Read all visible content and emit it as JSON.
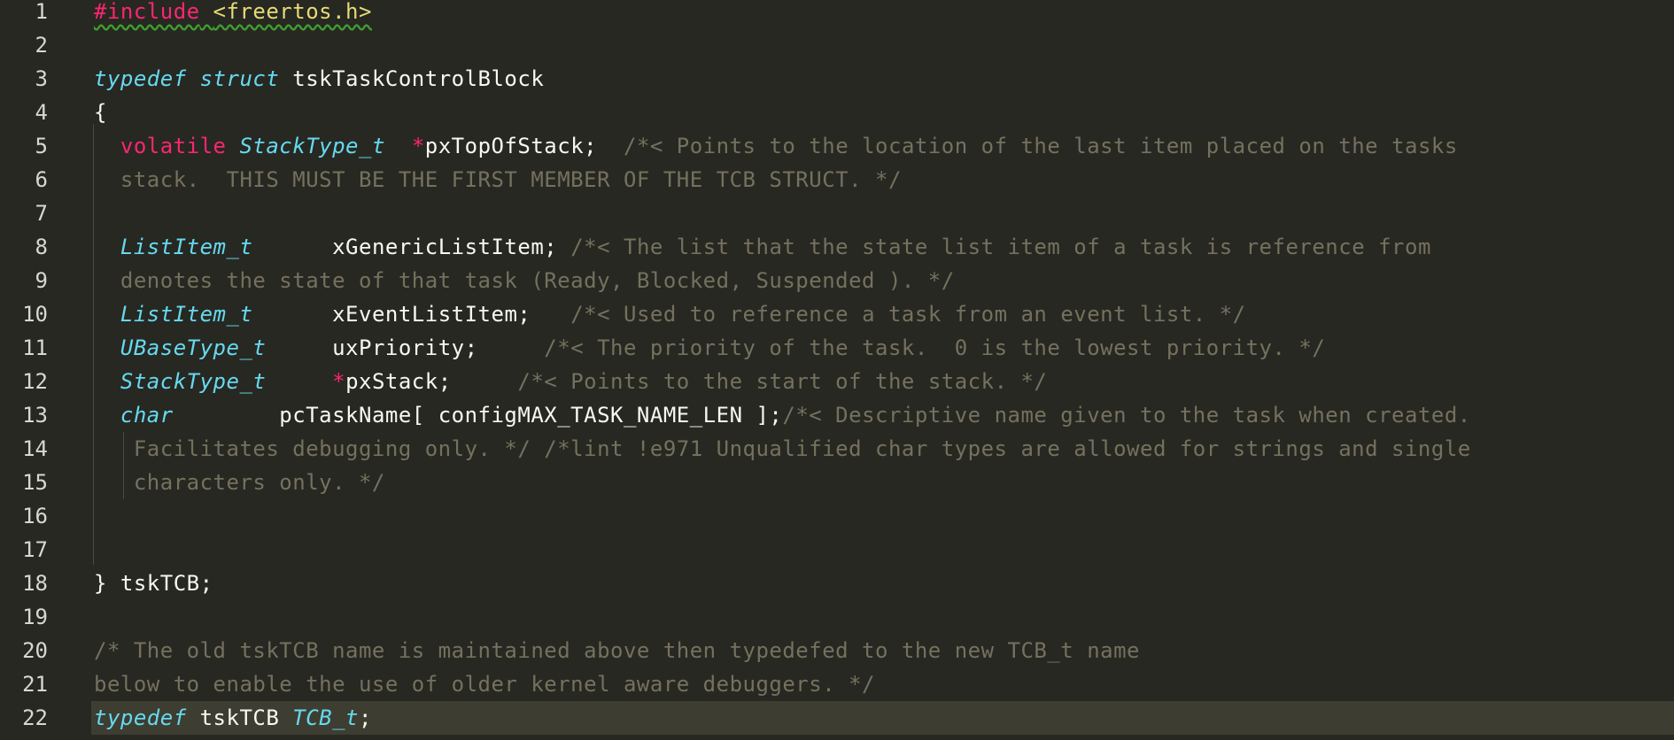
{
  "editor": {
    "theme": "monokai",
    "colors": {
      "background": "#272822",
      "active_line": "#3e3d32",
      "keyword": "#66d9ef",
      "preprocessor": "#f92672",
      "string": "#e6db74",
      "comment": "#75715e",
      "text": "#f8f8f2"
    },
    "active_line_number": "22",
    "lines": [
      {
        "num": "1",
        "tokens": [
          {
            "t": "#include",
            "c": "pre"
          },
          {
            "t": " ",
            "c": "id"
          },
          {
            "t": "<freertos.h>",
            "c": "inc"
          }
        ]
      },
      {
        "num": "2",
        "tokens": []
      },
      {
        "num": "3",
        "tokens": [
          {
            "t": "typedef struct",
            "c": "kw"
          },
          {
            "t": " tskTaskControlBlock",
            "c": "id"
          }
        ]
      },
      {
        "num": "4",
        "tokens": [
          {
            "t": "{",
            "c": "id"
          }
        ]
      },
      {
        "num": "5",
        "tokens": [
          {
            "t": "  ",
            "c": "id"
          },
          {
            "t": "volatile",
            "c": "red"
          },
          {
            "t": " ",
            "c": "id"
          },
          {
            "t": "StackType_t",
            "c": "kw"
          },
          {
            "t": "  ",
            "c": "id"
          },
          {
            "t": "*",
            "c": "red"
          },
          {
            "t": "pxTopOfStack;",
            "c": "id"
          },
          {
            "t": "  /*< Points to the location of the last item placed on the tasks",
            "c": "com"
          }
        ]
      },
      {
        "num": "6",
        "tokens": [
          {
            "t": "  stack.  THIS MUST BE THE FIRST MEMBER OF THE TCB STRUCT. */",
            "c": "com"
          }
        ]
      },
      {
        "num": "7",
        "tokens": []
      },
      {
        "num": "8",
        "tokens": [
          {
            "t": "  ",
            "c": "id"
          },
          {
            "t": "ListItem_t",
            "c": "kw"
          },
          {
            "t": "      xGenericListItem;",
            "c": "id"
          },
          {
            "t": " /*< The list that the state list item of a task is reference from",
            "c": "com"
          }
        ]
      },
      {
        "num": "9",
        "tokens": [
          {
            "t": "  denotes the state of that task (Ready, Blocked, Suspended ). */",
            "c": "com"
          }
        ]
      },
      {
        "num": "10",
        "tokens": [
          {
            "t": "  ",
            "c": "id"
          },
          {
            "t": "ListItem_t",
            "c": "kw"
          },
          {
            "t": "      xEventListItem;",
            "c": "id"
          },
          {
            "t": "   /*< Used to reference a task from an event list. */",
            "c": "com"
          }
        ]
      },
      {
        "num": "11",
        "tokens": [
          {
            "t": "  ",
            "c": "id"
          },
          {
            "t": "UBaseType_t",
            "c": "kw"
          },
          {
            "t": "     uxPriority;",
            "c": "id"
          },
          {
            "t": "     /*< The priority of the task.  0 is the lowest priority. */",
            "c": "com"
          }
        ]
      },
      {
        "num": "12",
        "tokens": [
          {
            "t": "  ",
            "c": "id"
          },
          {
            "t": "StackType_t",
            "c": "kw"
          },
          {
            "t": "     ",
            "c": "id"
          },
          {
            "t": "*",
            "c": "red"
          },
          {
            "t": "pxStack;",
            "c": "id"
          },
          {
            "t": "     /*< Points to the start of the stack. */",
            "c": "com"
          }
        ]
      },
      {
        "num": "13",
        "tokens": [
          {
            "t": "  ",
            "c": "id"
          },
          {
            "t": "char",
            "c": "kw"
          },
          {
            "t": "        pcTaskName[ configMAX_TASK_NAME_LEN ];",
            "c": "id"
          },
          {
            "t": "/*< Descriptive name given to the task when created.",
            "c": "com"
          }
        ]
      },
      {
        "num": "14",
        "tokens": [
          {
            "t": "   Facilitates debugging only. */ /*lint !e971 Unqualified char types are allowed for strings and single",
            "c": "com"
          }
        ]
      },
      {
        "num": "15",
        "tokens": [
          {
            "t": "   characters only. */",
            "c": "com"
          }
        ]
      },
      {
        "num": "16",
        "tokens": []
      },
      {
        "num": "17",
        "tokens": []
      },
      {
        "num": "18",
        "tokens": [
          {
            "t": "} tskTCB;",
            "c": "id"
          }
        ]
      },
      {
        "num": "19",
        "tokens": []
      },
      {
        "num": "20",
        "tokens": [
          {
            "t": "/* The old tskTCB name is maintained above then typedefed to the new TCB_t name",
            "c": "com"
          }
        ]
      },
      {
        "num": "21",
        "tokens": [
          {
            "t": "below to enable the use of older kernel aware debuggers. */",
            "c": "com"
          }
        ]
      },
      {
        "num": "22",
        "tokens": [
          {
            "t": "typedef",
            "c": "kw"
          },
          {
            "t": " tskTCB ",
            "c": "id"
          },
          {
            "t": "TCB_t",
            "c": "kw"
          },
          {
            "t": ";",
            "c": "id"
          }
        ]
      }
    ]
  }
}
